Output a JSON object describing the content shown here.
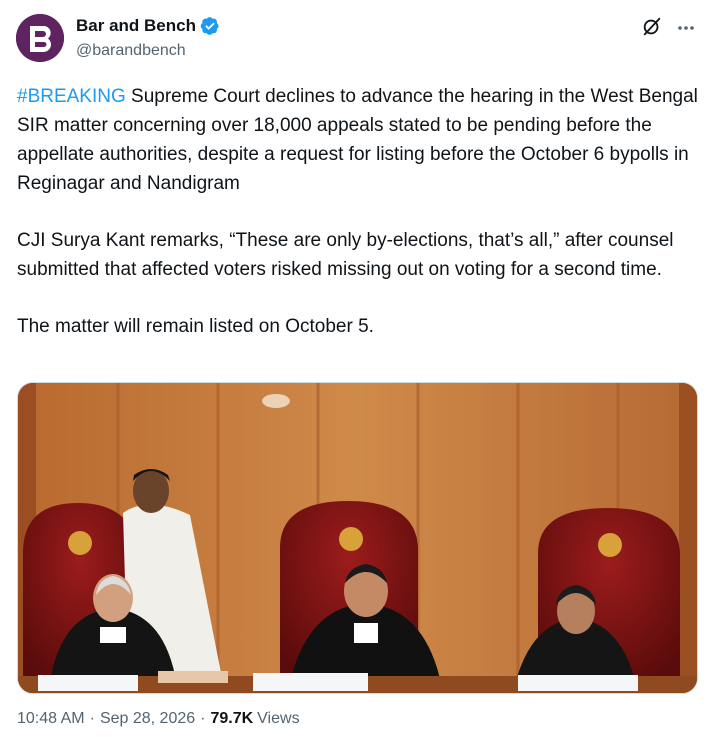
{
  "author": {
    "display_name": "Bar and Bench",
    "handle": "@barandbench",
    "verified": true,
    "avatar_letter": "B",
    "avatar_color": "#5d2460"
  },
  "tweet": {
    "hashtag": "#BREAKING",
    "paragraph1_rest": " Supreme Court declines to advance the hearing in the West Bengal SIR matter concerning over 18,000 appeals stated to be pending before the appellate authorities, despite a request for listing before the October 6 bypolls in Reginagar and Nandigram",
    "paragraph2": "CJI Surya Kant remarks, “These are only by-elections, that’s all,” after counsel submitted that affected voters risked missing out on voting for a second time.",
    "paragraph3": "The matter will remain listed on October 5."
  },
  "meta": {
    "time": "10:48 AM",
    "separator": "·",
    "date": "Sep 28, 2026",
    "views_count": "79.7K",
    "views_label": "Views"
  },
  "colors": {
    "link": "#1d9bf0",
    "secondary_text": "#536471",
    "verified": "#1d9bf0"
  },
  "icons": [
    "verified-badge-icon",
    "grok-icon",
    "more-icon"
  ]
}
